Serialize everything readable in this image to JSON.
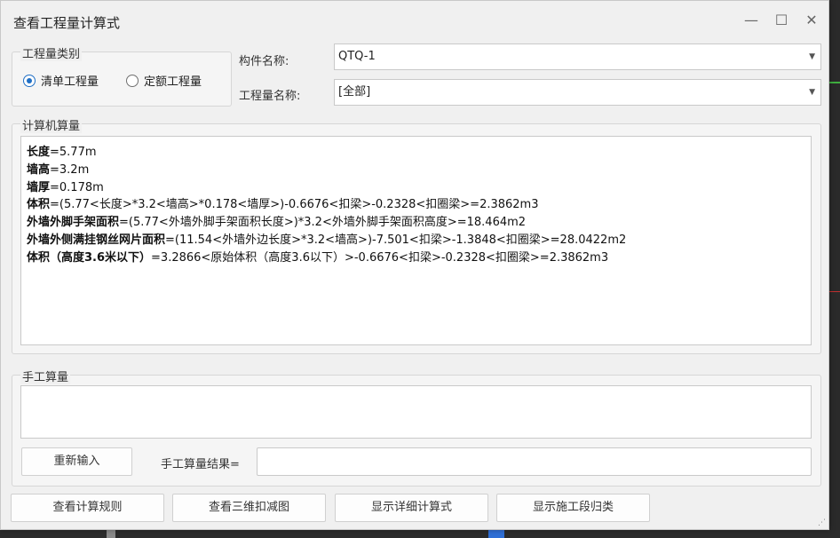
{
  "window": {
    "title": "查看工程量计算式",
    "minimize": "—",
    "maximize": "☐",
    "close": "✕"
  },
  "category": {
    "legend": "工程量类别",
    "options": [
      {
        "label": "清单工程量",
        "selected": true
      },
      {
        "label": "定额工程量",
        "selected": false
      }
    ]
  },
  "component": {
    "label": "构件名称:",
    "value": "QTQ-1"
  },
  "quantity_name": {
    "label": "工程量名称:",
    "value": "[全部]"
  },
  "computer": {
    "legend": "计算机算量",
    "lines": [
      {
        "name": "长度",
        "expr": "=5.77m"
      },
      {
        "name": "墙高",
        "expr": "=3.2m"
      },
      {
        "name": "墙厚",
        "expr": "=0.178m"
      },
      {
        "name": "体积",
        "expr": "=(5.77<长度>*3.2<墙高>*0.178<墙厚>)-0.6676<扣梁>-0.2328<扣圈梁>=2.3862m3"
      },
      {
        "name": "外墙外脚手架面积",
        "expr": "=(5.77<外墙外脚手架面积长度>)*3.2<外墙外脚手架面积高度>=18.464m2"
      },
      {
        "name": "外墙外侧满挂钢丝网片面积",
        "expr": "=(11.54<外墙外边长度>*3.2<墙高>)-7.501<扣梁>-1.3848<扣圈梁>=28.0422m2"
      },
      {
        "name": "体积（高度3.6米以下）",
        "expr": "=3.2866<原始体积（高度3.6以下）>-0.6676<扣梁>-0.2328<扣圈梁>=2.3862m3"
      }
    ]
  },
  "manual": {
    "legend": "手工算量",
    "reenter_button": "重新输入",
    "result_label": "手工算量结果=",
    "result_value": ""
  },
  "buttons": {
    "view_rules": "查看计算规则",
    "view_3d": "查看三维扣减图",
    "show_detail": "显示详细计算式",
    "show_section": "显示施工段归类"
  },
  "colors": {
    "accent": "#1f6fc5",
    "background": "#f0f0f0"
  }
}
